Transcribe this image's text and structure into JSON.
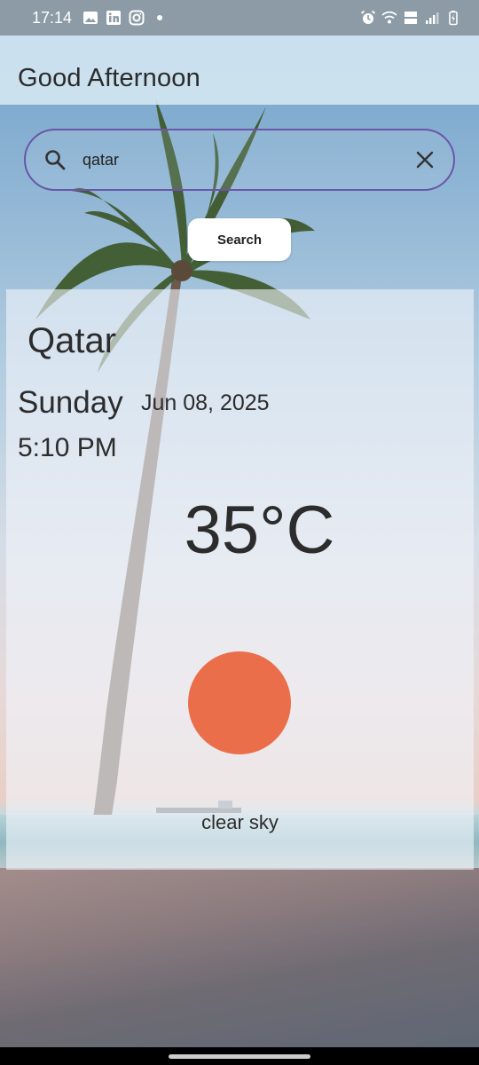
{
  "status_bar": {
    "time": "17:14",
    "left_icons": [
      "gallery-icon",
      "linkedin-icon",
      "instagram-icon"
    ],
    "right_icons": [
      "alarm-icon",
      "wifi-icon",
      "volte-icon",
      "signal-icon",
      "battery-icon"
    ]
  },
  "app_bar": {
    "title": "Good Afternoon"
  },
  "search": {
    "value": "qatar",
    "button_label": "Search"
  },
  "weather": {
    "city": "Qatar",
    "day": "Sunday",
    "date": "Jun 08, 2025",
    "time": "5:10 PM",
    "temperature": "35°C",
    "condition": "clear sky",
    "icon": "sun-icon",
    "icon_color": "#eb6e4a"
  },
  "colors": {
    "search_border": "#6a55a8",
    "app_bar_bg": "#d6e8f3"
  }
}
